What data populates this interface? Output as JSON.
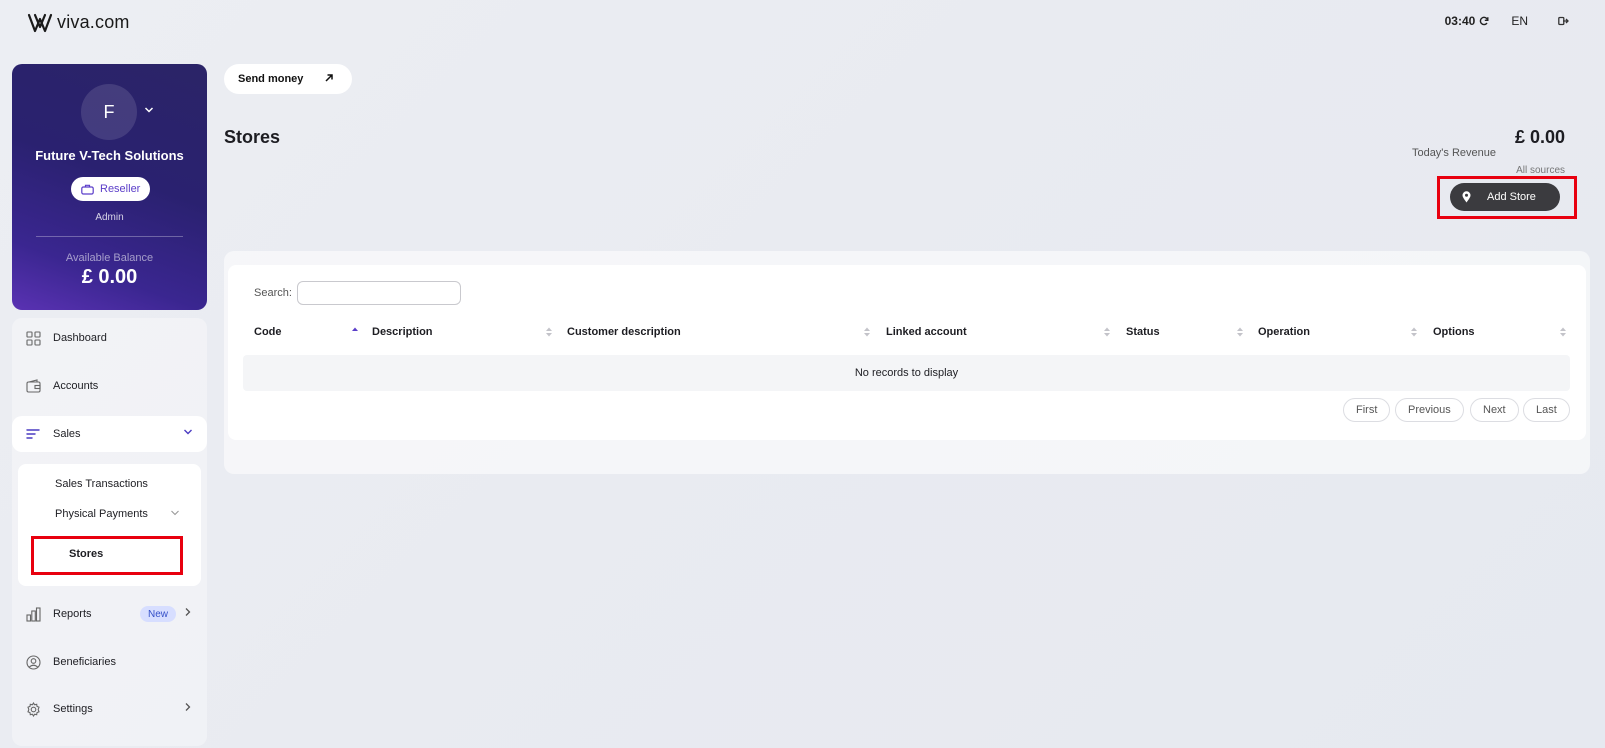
{
  "header": {
    "logo_text": "viva.com",
    "time": "03:40",
    "language": "EN",
    "refresh_icon": "refresh-icon",
    "logout_icon": "logout-icon"
  },
  "profile": {
    "avatar_initial": "F",
    "company": "Future V-Tech Solutions",
    "role": "Reseller",
    "subrole": "Admin",
    "balance_label": "Available Balance",
    "balance": "£ 0.00"
  },
  "sidebar": {
    "items": [
      {
        "label": "Dashboard",
        "icon": "dashboard-icon"
      },
      {
        "label": "Accounts",
        "icon": "wallet-icon"
      },
      {
        "label": "Sales",
        "icon": "sales-icon"
      },
      {
        "label": "Reports",
        "icon": "chart-icon",
        "badge": "New"
      },
      {
        "label": "Beneficiaries",
        "icon": "user-icon"
      },
      {
        "label": "Settings",
        "icon": "gear-icon"
      }
    ],
    "sales_sub": {
      "transactions": "Sales Transactions",
      "physical": "Physical Payments",
      "stores": "Stores"
    }
  },
  "main": {
    "send_money": "Send money",
    "title": "Stores",
    "revenue_value": "£ 0.00",
    "revenue_label": "Today's Revenue",
    "revenue_sub": "All sources",
    "add_store": "Add Store"
  },
  "table": {
    "search_label": "Search:",
    "search_value": "",
    "columns": [
      "Code",
      "Description",
      "Customer description",
      "Linked account",
      "Status",
      "Operation",
      "Options"
    ],
    "empty_message": "No records to display",
    "pagination": [
      "First",
      "Previous",
      "Next",
      "Last"
    ]
  },
  "colors": {
    "accent": "#5b3ec9",
    "highlight": "#e8000f",
    "card_gradient_start": "#2b2467",
    "card_gradient_end": "#5a32b3"
  }
}
